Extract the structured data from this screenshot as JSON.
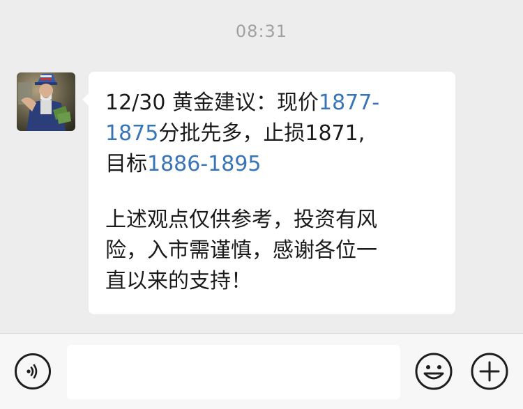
{
  "chat": {
    "timestamp": "08:31",
    "message": {
      "line1_prefix": "12/30   黄金建议：现价",
      "line1_link": "1877-",
      "line2_link": "1875",
      "line2_suffix": "分批先多，止损1871,",
      "line3_prefix": "目标",
      "line3_link": "1886-1895",
      "line4": "上述观点仅供参考，投资有风",
      "line5": "险，入市需谨慎，感谢各位一",
      "line6": "直以来的支持！"
    }
  },
  "input_bar": {
    "input_value": "",
    "voice_icon": "voice-icon",
    "emoji_icon": "emoji-icon",
    "plus_icon": "plus-icon"
  },
  "colors": {
    "link": "#3874b8",
    "background": "#ededed",
    "bubble": "#ffffff"
  }
}
